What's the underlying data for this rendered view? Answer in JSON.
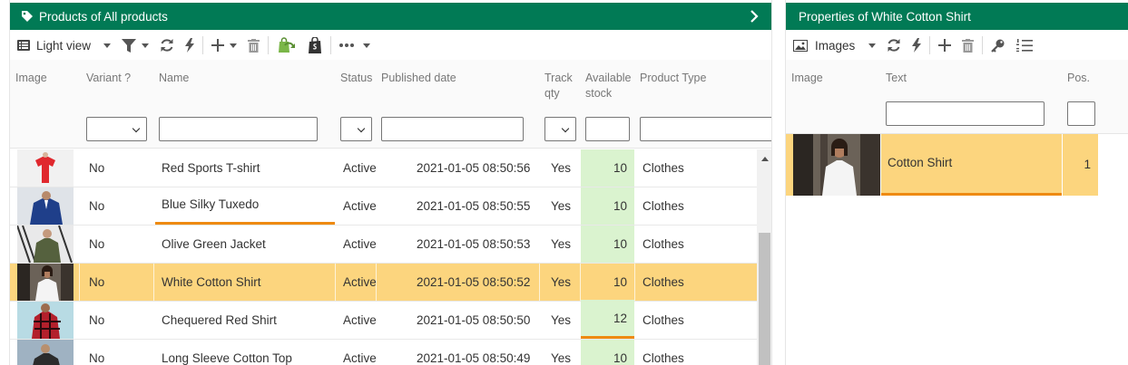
{
  "left": {
    "title": "Products of All products",
    "toolbar": {
      "view_label": "Light view"
    },
    "headers": {
      "image": "Image",
      "variant": "Variant ?",
      "name": "Name",
      "status": "Status",
      "published": "Published date",
      "track1": "Track",
      "track2": "qty",
      "stock1": "Available",
      "stock2": "stock",
      "type": "Product Type"
    },
    "rows": [
      {
        "variant": "No",
        "name": "Red Sports T-shirt",
        "status": "Active",
        "published": "2021-01-05 08:50:56",
        "track": "Yes",
        "stock": "10",
        "type": "Clothes",
        "image": "red-tshirt-photo"
      },
      {
        "variant": "No",
        "name": "Blue Silky Tuxedo",
        "status": "Active",
        "published": "2021-01-05 08:50:55",
        "track": "Yes",
        "stock": "10",
        "type": "Clothes",
        "image": "blue-tuxedo-photo"
      },
      {
        "variant": "No",
        "name": "Olive Green Jacket",
        "status": "Active",
        "published": "2021-01-05 08:50:53",
        "track": "Yes",
        "stock": "10",
        "type": "Clothes",
        "image": "green-jacket-photo"
      },
      {
        "variant": "No",
        "name": "White Cotton Shirt",
        "status": "Active",
        "published": "2021-01-05 08:50:52",
        "track": "Yes",
        "stock": "10",
        "type": "Clothes",
        "image": "white-shirt-photo",
        "selected": true
      },
      {
        "variant": "No",
        "name": "Chequered Red Shirt",
        "status": "Active",
        "published": "2021-01-05 08:50:50",
        "track": "Yes",
        "stock": "12",
        "type": "Clothes",
        "image": "chequered-shirt-photo"
      },
      {
        "variant": "No",
        "name": "Long Sleeve Cotton Top",
        "status": "Active",
        "published": "2021-01-05 08:50:49",
        "track": "Yes",
        "stock": "10",
        "type": "Clothes",
        "image": "cotton-top-photo"
      }
    ]
  },
  "right": {
    "title": "Properties of White Cotton Shirt",
    "toolbar": {
      "view_label": "Images"
    },
    "headers": {
      "image": "Image",
      "text": "Text",
      "pos": "Pos."
    },
    "row": {
      "text": "Cotton Shirt",
      "pos": "1",
      "image": "white-shirt-photo"
    }
  },
  "colors": {
    "header_green": "#017a55",
    "selected_row": "#fcd57e",
    "stock_cell": "#daf3cf",
    "edit_underline": "#ee8a12"
  }
}
